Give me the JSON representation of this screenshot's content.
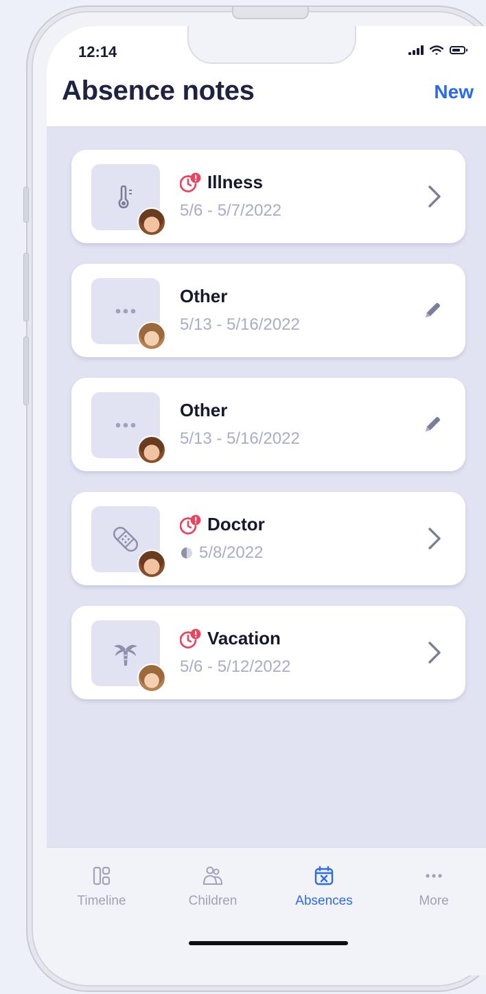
{
  "status_bar": {
    "time": "12:14"
  },
  "header": {
    "title": "Absence notes",
    "new_label": "New"
  },
  "notes": [
    {
      "title": "Illness",
      "date": "5/6 - 5/7/2022",
      "icon": "thermometer-icon",
      "alert": true,
      "half_day": false,
      "action": "chevron-right-icon"
    },
    {
      "title": "Other",
      "date": "5/13 - 5/16/2022",
      "icon": "ellipsis-icon",
      "alert": false,
      "half_day": false,
      "action": "pencil-icon"
    },
    {
      "title": "Other",
      "date": "5/13 - 5/16/2022",
      "icon": "ellipsis-icon",
      "alert": false,
      "half_day": false,
      "action": "pencil-icon"
    },
    {
      "title": "Doctor",
      "date": "5/8/2022",
      "icon": "bandage-icon",
      "alert": true,
      "half_day": true,
      "action": "chevron-right-icon"
    },
    {
      "title": "Vacation",
      "date": "5/6 - 5/12/2022",
      "icon": "palm-tree-icon",
      "alert": true,
      "half_day": false,
      "action": "chevron-right-icon"
    }
  ],
  "tabs": [
    {
      "label": "Timeline",
      "icon": "timeline-icon",
      "active": false
    },
    {
      "label": "Children",
      "icon": "children-icon",
      "active": false
    },
    {
      "label": "Absences",
      "icon": "absences-calendar-icon",
      "active": true
    },
    {
      "label": "More",
      "icon": "more-icon",
      "active": false
    }
  ],
  "colors": {
    "accent": "#2a6af1",
    "alert": "#e8455e",
    "background": "#e1e3f2",
    "muted_text": "#a9acc8"
  }
}
